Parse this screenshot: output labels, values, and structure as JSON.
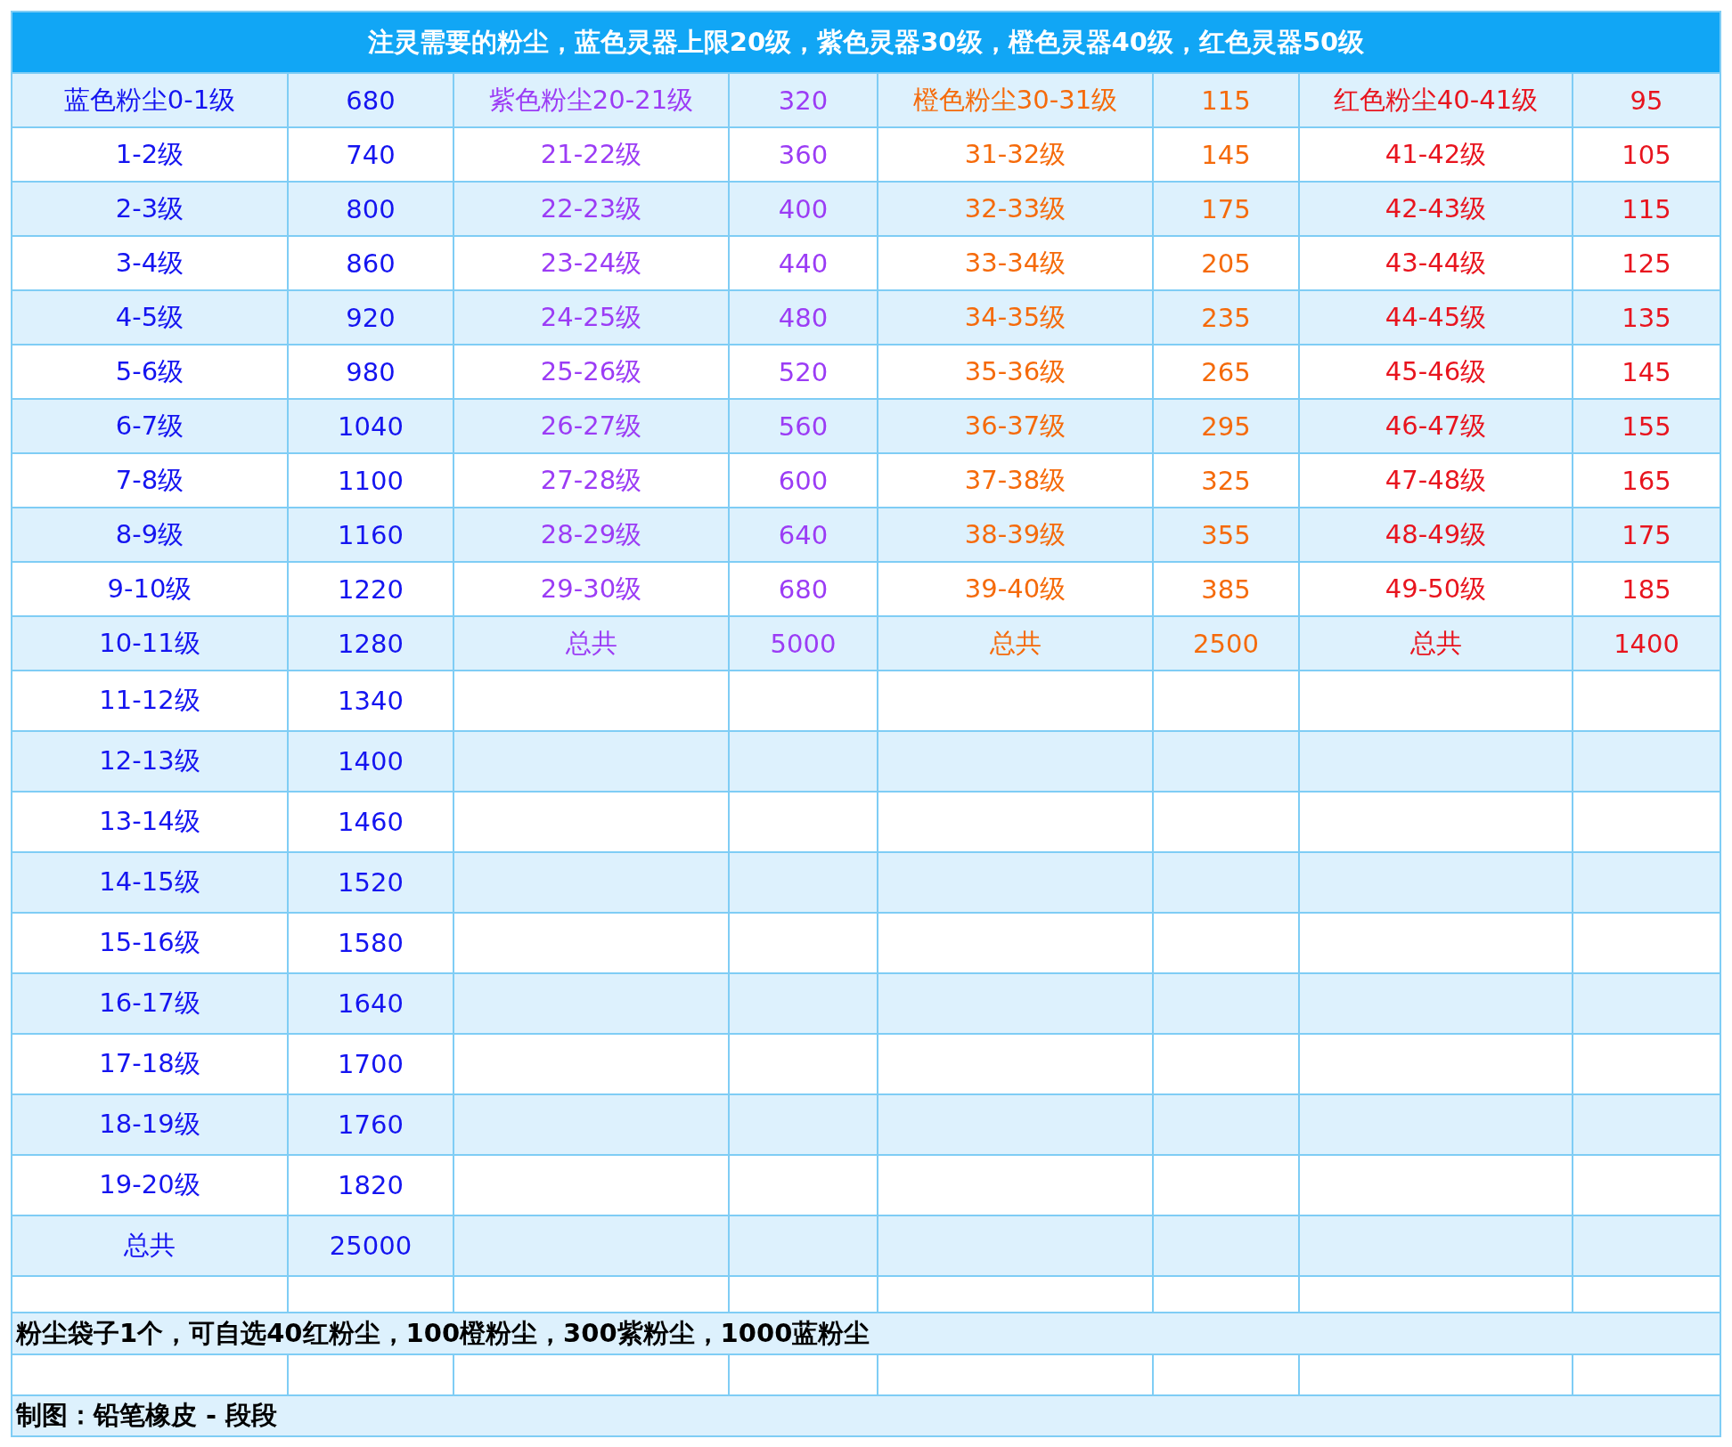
{
  "title": "注灵需要的粉尘，蓝色灵器上限20级，紫色灵器30级，橙色灵器40级，红色灵器50级",
  "groups": [
    {
      "color": "#1414f0",
      "rows": [
        {
          "label": "蓝色粉尘0-1级",
          "value": "680"
        },
        {
          "label": "1-2级",
          "value": "740"
        },
        {
          "label": "2-3级",
          "value": "800"
        },
        {
          "label": "3-4级",
          "value": "860"
        },
        {
          "label": "4-5级",
          "value": "920"
        },
        {
          "label": "5-6级",
          "value": "980"
        },
        {
          "label": "6-7级",
          "value": "1040"
        },
        {
          "label": "7-8级",
          "value": "1100"
        },
        {
          "label": "8-9级",
          "value": "1160"
        },
        {
          "label": "9-10级",
          "value": "1220"
        },
        {
          "label": "10-11级",
          "value": "1280"
        },
        {
          "label": "11-12级",
          "value": "1340"
        },
        {
          "label": "12-13级",
          "value": "1400"
        },
        {
          "label": "13-14级",
          "value": "1460"
        },
        {
          "label": "14-15级",
          "value": "1520"
        },
        {
          "label": "15-16级",
          "value": "1580"
        },
        {
          "label": "16-17级",
          "value": "1640"
        },
        {
          "label": "17-18级",
          "value": "1700"
        },
        {
          "label": "18-19级",
          "value": "1760"
        },
        {
          "label": "19-20级",
          "value": "1820"
        },
        {
          "label": "总共",
          "value": "25000"
        }
      ]
    },
    {
      "color": "#9b3cf5",
      "rows": [
        {
          "label": "紫色粉尘20-21级",
          "value": "320"
        },
        {
          "label": "21-22级",
          "value": "360"
        },
        {
          "label": "22-23级",
          "value": "400"
        },
        {
          "label": "23-24级",
          "value": "440"
        },
        {
          "label": "24-25级",
          "value": "480"
        },
        {
          "label": "25-26级",
          "value": "520"
        },
        {
          "label": "26-27级",
          "value": "560"
        },
        {
          "label": "27-28级",
          "value": "600"
        },
        {
          "label": "28-29级",
          "value": "640"
        },
        {
          "label": "29-30级",
          "value": "680"
        },
        {
          "label": "总共",
          "value": "5000"
        }
      ]
    },
    {
      "color": "#f56a0a",
      "rows": [
        {
          "label": "橙色粉尘30-31级",
          "value": "115"
        },
        {
          "label": "31-32级",
          "value": "145"
        },
        {
          "label": "32-33级",
          "value": "175"
        },
        {
          "label": "33-34级",
          "value": "205"
        },
        {
          "label": "34-35级",
          "value": "235"
        },
        {
          "label": "35-36级",
          "value": "265"
        },
        {
          "label": "36-37级",
          "value": "295"
        },
        {
          "label": "37-38级",
          "value": "325"
        },
        {
          "label": "38-39级",
          "value": "355"
        },
        {
          "label": "39-40级",
          "value": "385"
        },
        {
          "label": "总共",
          "value": "2500"
        }
      ]
    },
    {
      "color": "#e8141e",
      "rows": [
        {
          "label": "红色粉尘40-41级",
          "value": "95"
        },
        {
          "label": "41-42级",
          "value": "105"
        },
        {
          "label": "42-43级",
          "value": "115"
        },
        {
          "label": "43-44级",
          "value": "125"
        },
        {
          "label": "44-45级",
          "value": "135"
        },
        {
          "label": "45-46级",
          "value": "145"
        },
        {
          "label": "46-47级",
          "value": "155"
        },
        {
          "label": "47-48级",
          "value": "165"
        },
        {
          "label": "48-49级",
          "value": "175"
        },
        {
          "label": "49-50级",
          "value": "185"
        },
        {
          "label": "总共",
          "value": "1400"
        }
      ]
    }
  ],
  "note": "粉尘袋子1个，可自选40红粉尘，100橙粉尘，300紫粉尘，1000蓝粉尘",
  "credit": "制图：铅笔橡皮 - 段段"
}
